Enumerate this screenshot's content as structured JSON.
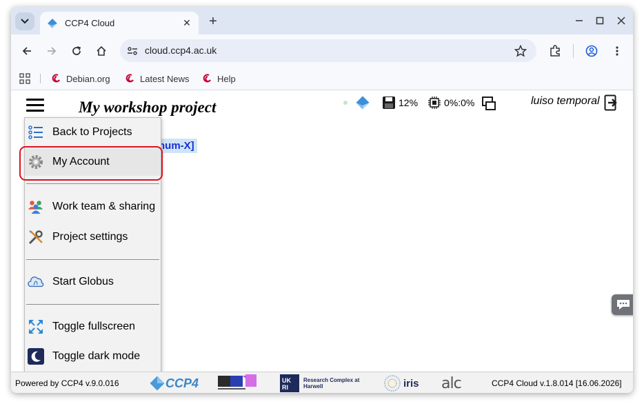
{
  "browser": {
    "tab_title": "CCP4 Cloud",
    "url": "cloud.ccp4.ac.uk",
    "bookmarks": [
      {
        "label": "Debian.org"
      },
      {
        "label": "Latest News"
      },
      {
        "label": "Help"
      }
    ]
  },
  "app": {
    "project_title": "My workshop project",
    "disk_usage": "12%",
    "cpu_usage": "0%:0%",
    "user_name": "luiso temporal",
    "background_label": "num-X]"
  },
  "menu": {
    "items": [
      {
        "label": "Back to Projects",
        "icon": "list-icon"
      },
      {
        "label": "My Account",
        "icon": "gear-icon"
      },
      {
        "label": "Work team & sharing",
        "icon": "team-icon"
      },
      {
        "label": "Project settings",
        "icon": "tools-icon"
      },
      {
        "label": "Start Globus",
        "icon": "globus-cloud-icon"
      },
      {
        "label": "Toggle fullscreen",
        "icon": "fullscreen-icon"
      },
      {
        "label": "Toggle dark mode",
        "icon": "moon-icon"
      }
    ]
  },
  "footer": {
    "powered_by": "Powered by CCP4 v.9.0.016",
    "version": "CCP4 Cloud v.1.8.014 [16.06.2026]",
    "logos": {
      "ccp4": "CCP4",
      "rch": "Research Complex at Harwell",
      "iris": "iris",
      "alc": "alc"
    }
  },
  "colors": {
    "highlight": "#e0101a",
    "link_blue": "#1a2fd0",
    "chrome_frame": "#dfe6f3"
  }
}
